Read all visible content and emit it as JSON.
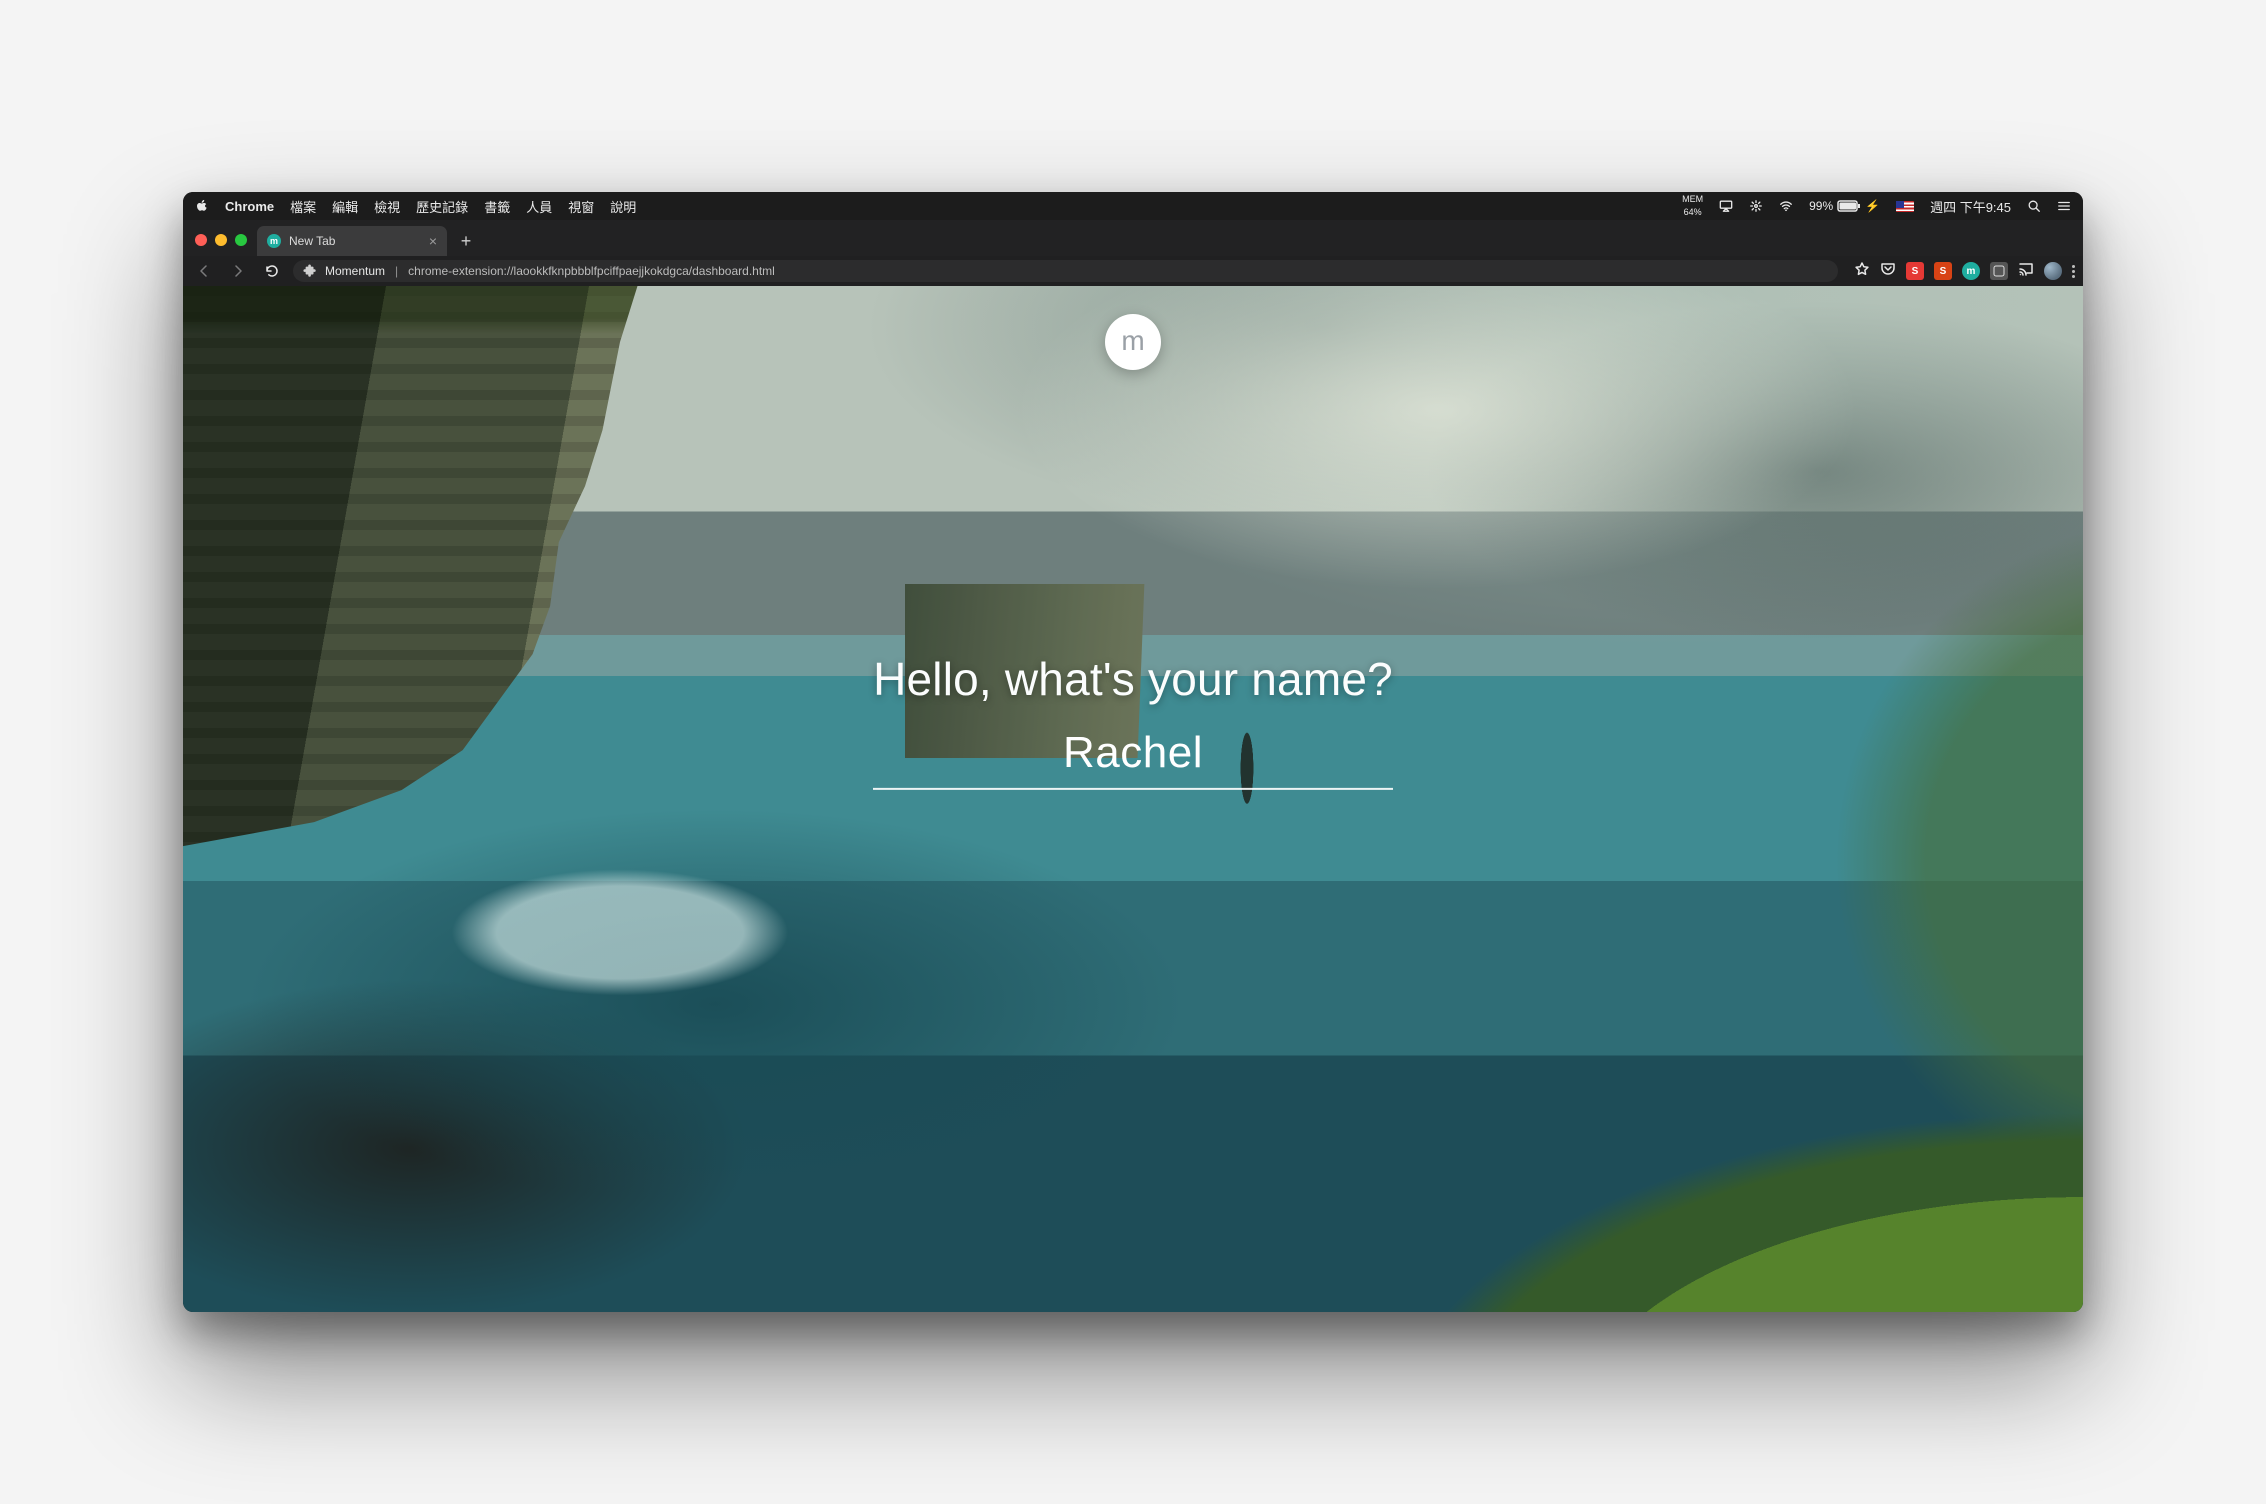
{
  "menubar": {
    "app": "Chrome",
    "items": [
      "檔案",
      "編輯",
      "檢視",
      "歷史記錄",
      "書籤",
      "人員",
      "視窗",
      "說明"
    ],
    "mem_label": "MEM",
    "mem_value": "64%",
    "battery": "99%",
    "charging_glyph": "⚡",
    "clock": "週四 下午9:45"
  },
  "tabbar": {
    "active_tab_title": "New Tab",
    "favicon_letter": "m"
  },
  "urlbar": {
    "host": "Momentum",
    "url": "chrome-extension://laookkfknpbbblfpciffpaejjkokdgca/dashboard.html"
  },
  "extension_chips": {
    "s": "S",
    "s2": "S",
    "m": "m"
  },
  "momentum": {
    "logo_letter": "m",
    "prompt": "Hello, what's your name?",
    "name_value": "Rachel"
  }
}
